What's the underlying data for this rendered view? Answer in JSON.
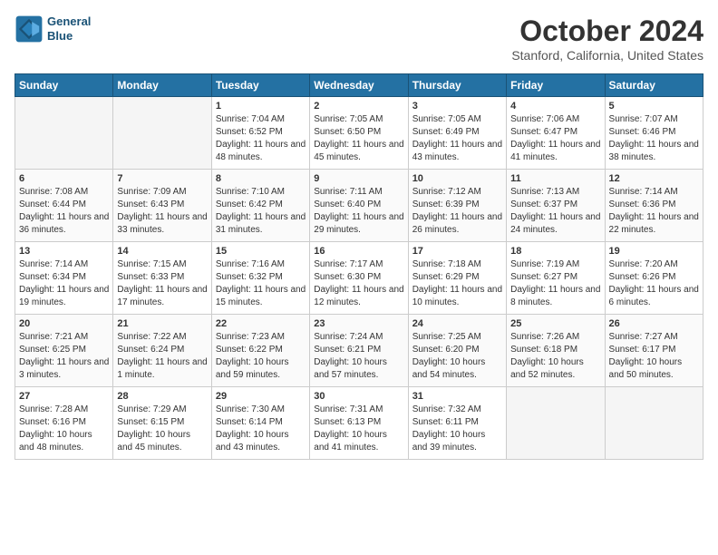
{
  "header": {
    "logo_line1": "General",
    "logo_line2": "Blue",
    "month": "October 2024",
    "location": "Stanford, California, United States"
  },
  "weekdays": [
    "Sunday",
    "Monday",
    "Tuesday",
    "Wednesday",
    "Thursday",
    "Friday",
    "Saturday"
  ],
  "weeks": [
    [
      {
        "day": "",
        "sunrise": "",
        "sunset": "",
        "daylight": "",
        "empty": true
      },
      {
        "day": "",
        "sunrise": "",
        "sunset": "",
        "daylight": "",
        "empty": true
      },
      {
        "day": "1",
        "sunrise": "Sunrise: 7:04 AM",
        "sunset": "Sunset: 6:52 PM",
        "daylight": "Daylight: 11 hours and 48 minutes.",
        "empty": false
      },
      {
        "day": "2",
        "sunrise": "Sunrise: 7:05 AM",
        "sunset": "Sunset: 6:50 PM",
        "daylight": "Daylight: 11 hours and 45 minutes.",
        "empty": false
      },
      {
        "day": "3",
        "sunrise": "Sunrise: 7:05 AM",
        "sunset": "Sunset: 6:49 PM",
        "daylight": "Daylight: 11 hours and 43 minutes.",
        "empty": false
      },
      {
        "day": "4",
        "sunrise": "Sunrise: 7:06 AM",
        "sunset": "Sunset: 6:47 PM",
        "daylight": "Daylight: 11 hours and 41 minutes.",
        "empty": false
      },
      {
        "day": "5",
        "sunrise": "Sunrise: 7:07 AM",
        "sunset": "Sunset: 6:46 PM",
        "daylight": "Daylight: 11 hours and 38 minutes.",
        "empty": false
      }
    ],
    [
      {
        "day": "6",
        "sunrise": "Sunrise: 7:08 AM",
        "sunset": "Sunset: 6:44 PM",
        "daylight": "Daylight: 11 hours and 36 minutes.",
        "empty": false
      },
      {
        "day": "7",
        "sunrise": "Sunrise: 7:09 AM",
        "sunset": "Sunset: 6:43 PM",
        "daylight": "Daylight: 11 hours and 33 minutes.",
        "empty": false
      },
      {
        "day": "8",
        "sunrise": "Sunrise: 7:10 AM",
        "sunset": "Sunset: 6:42 PM",
        "daylight": "Daylight: 11 hours and 31 minutes.",
        "empty": false
      },
      {
        "day": "9",
        "sunrise": "Sunrise: 7:11 AM",
        "sunset": "Sunset: 6:40 PM",
        "daylight": "Daylight: 11 hours and 29 minutes.",
        "empty": false
      },
      {
        "day": "10",
        "sunrise": "Sunrise: 7:12 AM",
        "sunset": "Sunset: 6:39 PM",
        "daylight": "Daylight: 11 hours and 26 minutes.",
        "empty": false
      },
      {
        "day": "11",
        "sunrise": "Sunrise: 7:13 AM",
        "sunset": "Sunset: 6:37 PM",
        "daylight": "Daylight: 11 hours and 24 minutes.",
        "empty": false
      },
      {
        "day": "12",
        "sunrise": "Sunrise: 7:14 AM",
        "sunset": "Sunset: 6:36 PM",
        "daylight": "Daylight: 11 hours and 22 minutes.",
        "empty": false
      }
    ],
    [
      {
        "day": "13",
        "sunrise": "Sunrise: 7:14 AM",
        "sunset": "Sunset: 6:34 PM",
        "daylight": "Daylight: 11 hours and 19 minutes.",
        "empty": false
      },
      {
        "day": "14",
        "sunrise": "Sunrise: 7:15 AM",
        "sunset": "Sunset: 6:33 PM",
        "daylight": "Daylight: 11 hours and 17 minutes.",
        "empty": false
      },
      {
        "day": "15",
        "sunrise": "Sunrise: 7:16 AM",
        "sunset": "Sunset: 6:32 PM",
        "daylight": "Daylight: 11 hours and 15 minutes.",
        "empty": false
      },
      {
        "day": "16",
        "sunrise": "Sunrise: 7:17 AM",
        "sunset": "Sunset: 6:30 PM",
        "daylight": "Daylight: 11 hours and 12 minutes.",
        "empty": false
      },
      {
        "day": "17",
        "sunrise": "Sunrise: 7:18 AM",
        "sunset": "Sunset: 6:29 PM",
        "daylight": "Daylight: 11 hours and 10 minutes.",
        "empty": false
      },
      {
        "day": "18",
        "sunrise": "Sunrise: 7:19 AM",
        "sunset": "Sunset: 6:27 PM",
        "daylight": "Daylight: 11 hours and 8 minutes.",
        "empty": false
      },
      {
        "day": "19",
        "sunrise": "Sunrise: 7:20 AM",
        "sunset": "Sunset: 6:26 PM",
        "daylight": "Daylight: 11 hours and 6 minutes.",
        "empty": false
      }
    ],
    [
      {
        "day": "20",
        "sunrise": "Sunrise: 7:21 AM",
        "sunset": "Sunset: 6:25 PM",
        "daylight": "Daylight: 11 hours and 3 minutes.",
        "empty": false
      },
      {
        "day": "21",
        "sunrise": "Sunrise: 7:22 AM",
        "sunset": "Sunset: 6:24 PM",
        "daylight": "Daylight: 11 hours and 1 minute.",
        "empty": false
      },
      {
        "day": "22",
        "sunrise": "Sunrise: 7:23 AM",
        "sunset": "Sunset: 6:22 PM",
        "daylight": "Daylight: 10 hours and 59 minutes.",
        "empty": false
      },
      {
        "day": "23",
        "sunrise": "Sunrise: 7:24 AM",
        "sunset": "Sunset: 6:21 PM",
        "daylight": "Daylight: 10 hours and 57 minutes.",
        "empty": false
      },
      {
        "day": "24",
        "sunrise": "Sunrise: 7:25 AM",
        "sunset": "Sunset: 6:20 PM",
        "daylight": "Daylight: 10 hours and 54 minutes.",
        "empty": false
      },
      {
        "day": "25",
        "sunrise": "Sunrise: 7:26 AM",
        "sunset": "Sunset: 6:18 PM",
        "daylight": "Daylight: 10 hours and 52 minutes.",
        "empty": false
      },
      {
        "day": "26",
        "sunrise": "Sunrise: 7:27 AM",
        "sunset": "Sunset: 6:17 PM",
        "daylight": "Daylight: 10 hours and 50 minutes.",
        "empty": false
      }
    ],
    [
      {
        "day": "27",
        "sunrise": "Sunrise: 7:28 AM",
        "sunset": "Sunset: 6:16 PM",
        "daylight": "Daylight: 10 hours and 48 minutes.",
        "empty": false
      },
      {
        "day": "28",
        "sunrise": "Sunrise: 7:29 AM",
        "sunset": "Sunset: 6:15 PM",
        "daylight": "Daylight: 10 hours and 45 minutes.",
        "empty": false
      },
      {
        "day": "29",
        "sunrise": "Sunrise: 7:30 AM",
        "sunset": "Sunset: 6:14 PM",
        "daylight": "Daylight: 10 hours and 43 minutes.",
        "empty": false
      },
      {
        "day": "30",
        "sunrise": "Sunrise: 7:31 AM",
        "sunset": "Sunset: 6:13 PM",
        "daylight": "Daylight: 10 hours and 41 minutes.",
        "empty": false
      },
      {
        "day": "31",
        "sunrise": "Sunrise: 7:32 AM",
        "sunset": "Sunset: 6:11 PM",
        "daylight": "Daylight: 10 hours and 39 minutes.",
        "empty": false
      },
      {
        "day": "",
        "sunrise": "",
        "sunset": "",
        "daylight": "",
        "empty": true
      },
      {
        "day": "",
        "sunrise": "",
        "sunset": "",
        "daylight": "",
        "empty": true
      }
    ]
  ]
}
